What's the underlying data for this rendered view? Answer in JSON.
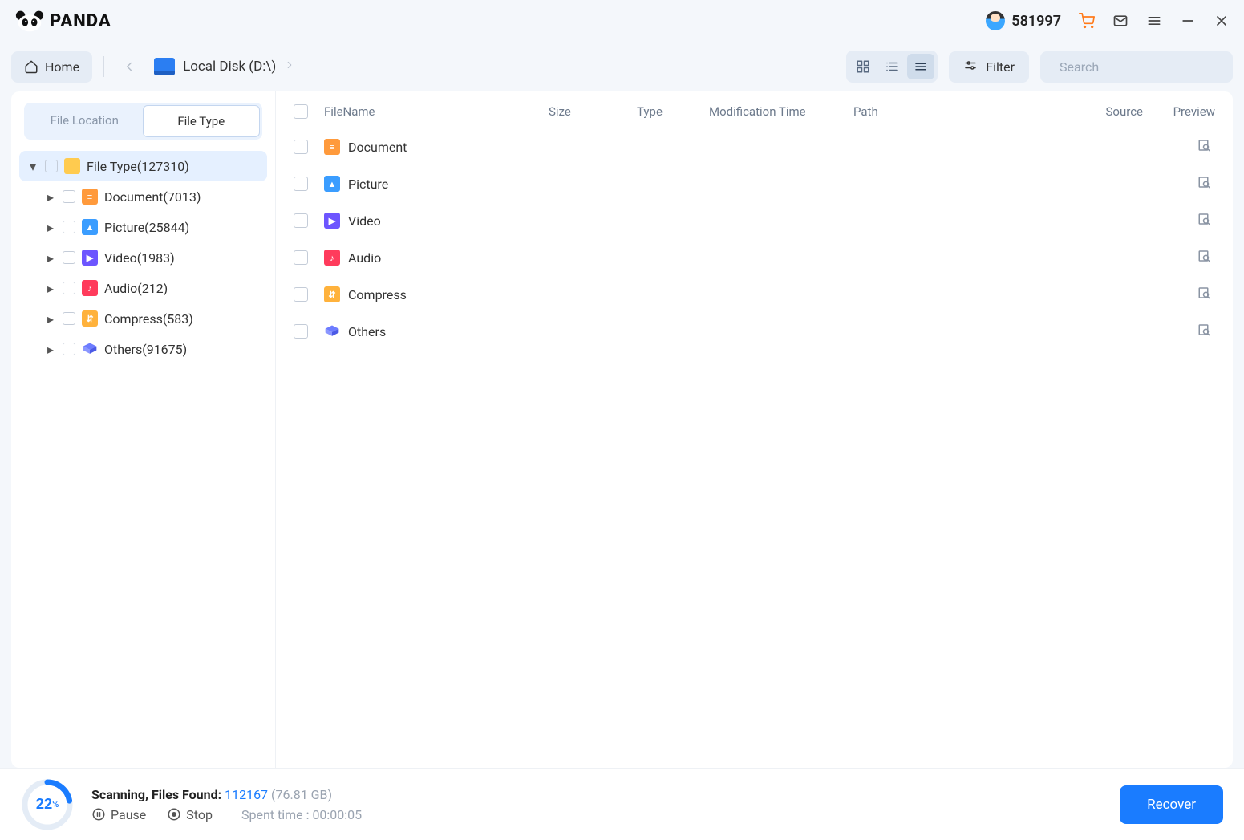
{
  "app": {
    "name": "PANDA"
  },
  "titlebar": {
    "user_id": "581997"
  },
  "toolbar": {
    "home_label": "Home",
    "breadcrumb": "Local Disk (D:\\)",
    "filter_label": "Filter",
    "search_placeholder": "Search"
  },
  "sidebar": {
    "tabs": {
      "location": "File Location",
      "type": "File Type"
    },
    "root": {
      "label": "File Type(127310)"
    },
    "items": [
      {
        "label": "Document(7013)",
        "icon": "doc"
      },
      {
        "label": "Picture(25844)",
        "icon": "pic"
      },
      {
        "label": "Video(1983)",
        "icon": "vid"
      },
      {
        "label": "Audio(212)",
        "icon": "aud"
      },
      {
        "label": "Compress(583)",
        "icon": "zip"
      },
      {
        "label": "Others(91675)",
        "icon": "oth"
      }
    ]
  },
  "columns": {
    "name": "FileName",
    "size": "Size",
    "type": "Type",
    "mod": "Modification Time",
    "path": "Path",
    "src": "Source",
    "prev": "Preview"
  },
  "rows": [
    {
      "label": "Document",
      "icon": "doc"
    },
    {
      "label": "Picture",
      "icon": "pic"
    },
    {
      "label": "Video",
      "icon": "vid"
    },
    {
      "label": "Audio",
      "icon": "aud"
    },
    {
      "label": "Compress",
      "icon": "zip"
    },
    {
      "label": "Others",
      "icon": "oth"
    }
  ],
  "footer": {
    "percent": "22",
    "status_label": "Scanning, Files Found:",
    "count": "112167",
    "size": "(76.81 GB)",
    "pause": "Pause",
    "stop": "Stop",
    "spent_label": "Spent time : ",
    "spent_value": "00:00:05",
    "recover": "Recover"
  }
}
